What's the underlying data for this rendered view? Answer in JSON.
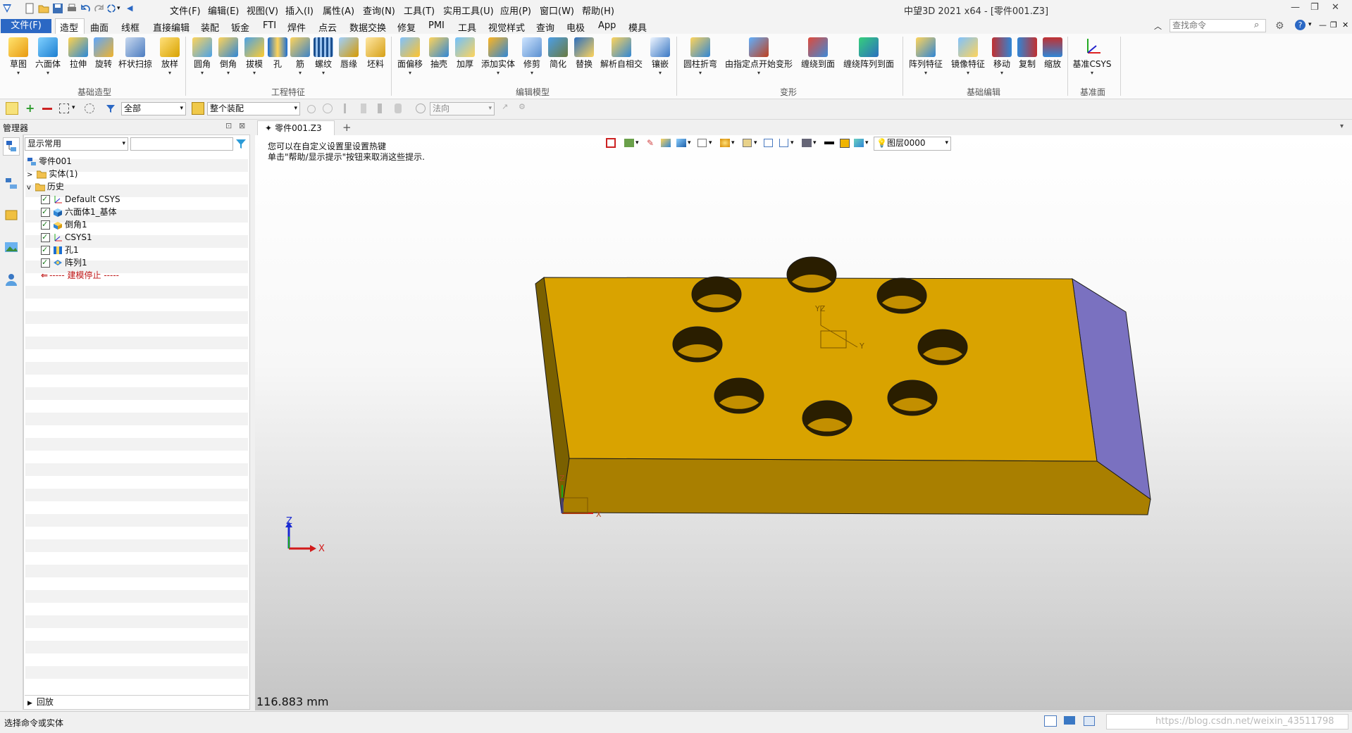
{
  "titlebar": {
    "menus": [
      "文件(F)",
      "编辑(E)",
      "视图(V)",
      "插入(I)",
      "属性(A)",
      "查询(N)",
      "工具(T)",
      "实用工具(U)",
      "应用(P)",
      "窗口(W)",
      "帮助(H)"
    ],
    "title": "中望3D 2021 x64 - [零件001.Z3]"
  },
  "tabs": {
    "file": "文件(F)",
    "items": [
      "造型",
      "曲面",
      "线框",
      "直接编辑",
      "装配",
      "钣金",
      "FTI",
      "焊件",
      "点云",
      "数据交换",
      "修复",
      "PMI",
      "工具",
      "视觉样式",
      "查询",
      "电极",
      "App",
      "模具"
    ],
    "search_placeholder": "查找命令"
  },
  "ribbon": {
    "groups": [
      {
        "label": "基础造型",
        "buttons": [
          "草图",
          "六面体",
          "拉伸",
          "旋转",
          "杆状扫掠",
          "放样"
        ]
      },
      {
        "label": "工程特征",
        "buttons": [
          "圆角",
          "倒角",
          "拔模",
          "孔",
          "筋",
          "螺纹",
          "唇缘",
          "坯料"
        ]
      },
      {
        "label": "编辑模型",
        "buttons": [
          "面偏移",
          "抽壳",
          "加厚",
          "添加实体",
          "修剪",
          "简化",
          "替换",
          "解析自相交",
          "镶嵌"
        ]
      },
      {
        "label": "变形",
        "buttons": [
          "圆柱折弯",
          "由指定点开始变形",
          "缠绕到面",
          "缠绕阵列到面"
        ]
      },
      {
        "label": "基础编辑",
        "buttons": [
          "阵列特征",
          "镜像特征",
          "移动",
          "复制",
          "缩放"
        ]
      },
      {
        "label": "基准面",
        "buttons": [
          "基准CSYS"
        ]
      }
    ]
  },
  "toolbar2": {
    "filter_value": "全部",
    "scope_value": "整个装配",
    "direction_value": "法向"
  },
  "manager": {
    "title": "管理器",
    "filter_value": "显示常用",
    "root": "零件001",
    "solids": "实体(1)",
    "history": "历史",
    "features": [
      "Default CSYS",
      "六面体1_基体",
      "倒角1",
      "CSYS1",
      "孔1",
      "阵列1"
    ],
    "stop": "----- 建模停止 -----",
    "playback": "回放"
  },
  "document": {
    "tab_label": "零件001.Z3",
    "hint_line1": "您可以在自定义设置里设置热键",
    "hint_line2": "单击\"帮助/显示提示\"按钮来取消这些提示.",
    "layer": "图层0000",
    "distance": "116.883 mm",
    "axis_x": "X",
    "axis_z": "Z",
    "csys_x": "X",
    "csys_z": "Z",
    "colors": {
      "top": "#d9a300",
      "front": "#a97f00",
      "side": "#7a71c0"
    }
  },
  "statusbar": {
    "message": "选择命令或实体",
    "watermark": "https://blog.csdn.net/weixin_43511798"
  }
}
